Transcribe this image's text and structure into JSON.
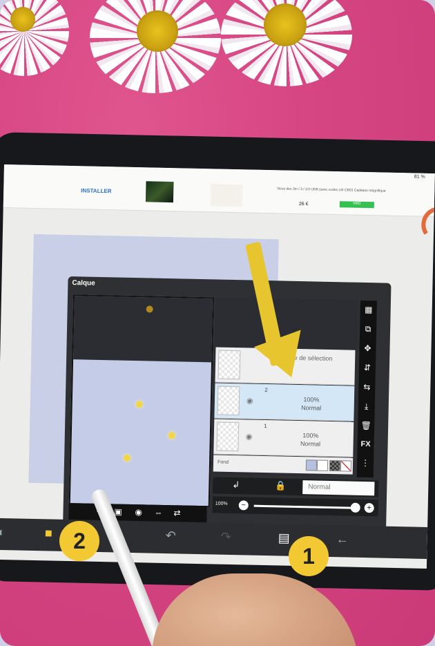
{
  "ad": {
    "install_label": "INSTALLER",
    "info_text": "Nous des 3m / 3 / 1/3 UDB (avec codes LM CBO) Cadeaux magnifique",
    "price": "26 €",
    "cta": "MBD"
  },
  "status_bar": {
    "battery": "81 %"
  },
  "layers_panel": {
    "title": "Calque",
    "layers": [
      {
        "number": "",
        "label": "Calque de sélection",
        "opacity": "",
        "mode": ""
      },
      {
        "number": "2",
        "label": "",
        "opacity": "100%",
        "mode": "Normal",
        "active": true
      },
      {
        "number": "1",
        "label": "",
        "opacity": "100%",
        "mode": "Normal"
      }
    ],
    "background_label": "Fond",
    "blend_mode": "Normal",
    "opacity_label": "100%",
    "side_tool_icons": [
      "checker-icon",
      "copy-layer-icon",
      "move-icon",
      "flip-vertical-icon",
      "flip-horizontal-icon",
      "merge-down-icon",
      "trash-icon",
      "fx-icon",
      "more-icon"
    ],
    "fx_label": "FX"
  },
  "preview_tools": [
    "add-layer-icon",
    "add-folder-icon",
    "camera-icon",
    "flip-icon",
    "transform-icon"
  ],
  "badges": {
    "one": "1",
    "two": "2"
  },
  "colors": {
    "accent_yellow": "#f2c933",
    "panel_dark": "#2f3033",
    "active_layer": "#d3e7f6"
  }
}
